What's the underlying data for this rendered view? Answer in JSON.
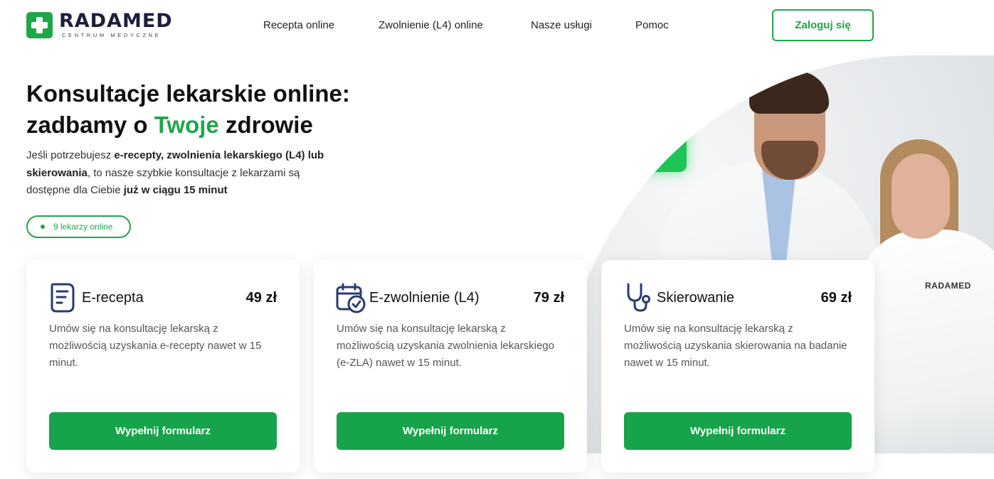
{
  "brand": {
    "name": "RADAMED",
    "tagline": "CENTRUM MEDYCZNE",
    "accent": "#1fa64a"
  },
  "nav": {
    "items": [
      {
        "label": "Recepta online"
      },
      {
        "label": "Zwolnienie (L4) online"
      },
      {
        "label": "Nasze usługi"
      },
      {
        "label": "Pomoc"
      }
    ],
    "login_label": "Zaloguj się"
  },
  "hero": {
    "title_line1": "Konsultacje lekarskie online:",
    "title_line2_prefix": "zadbamy o ",
    "title_line2_accent": "Twoje",
    "title_line2_suffix": " zdrowie",
    "desc_parts": [
      "Jeśli potrzebujesz ",
      "e-recepty, zwolnienia lekarskiego (L4) lub skierowania",
      ", to nasze szybkie konsultacje z lekarzami są dostępne dla Ciebie ",
      "już w ciągu 15 minut"
    ],
    "online_badge": "9 lekarzy online",
    "coat_label": "RADAMED"
  },
  "cards": [
    {
      "icon": "prescription-icon",
      "title": "E-recepta",
      "price": "49 zł",
      "description": "Umów się na konsultację lekarską z możliwością uzyskania e-recepty nawet w 15 minut.",
      "button": "Wypełnij formularz"
    },
    {
      "icon": "calendar-check-icon",
      "title": "E-zwolnienie (L4)",
      "price": "79 zł",
      "description": "Umów się na konsultację lekarską z możliwością uzyskania zwolnienia lekarskiego (e-ZLA) nawet w 15 minut.",
      "button": "Wypełnij formularz"
    },
    {
      "icon": "stethoscope-icon",
      "title": "Skierowanie",
      "price": "69 zł",
      "description": "Umów się na konsultację lekarską z możliwością uzyskania skierowania na badanie nawet w 15 minut.",
      "button": "Wypełnij formularz"
    }
  ]
}
